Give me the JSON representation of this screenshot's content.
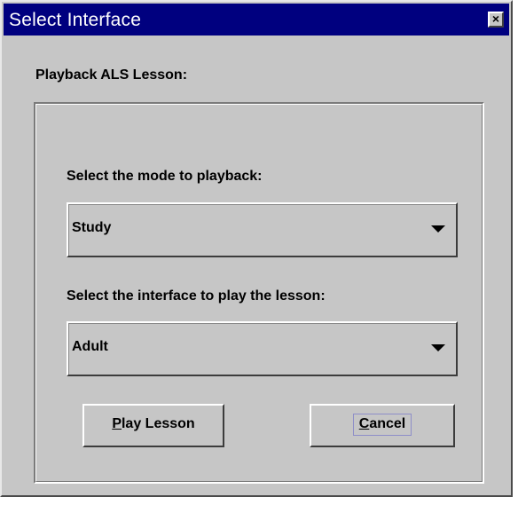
{
  "window": {
    "title": "Select Interface",
    "close_glyph": "×",
    "close_icon": "close-icon"
  },
  "group": {
    "label": "Playback ALS Lesson:"
  },
  "mode_field": {
    "label": "Select the mode to playback:",
    "selected": "Study",
    "dropdown_icon": "chevron-down-icon"
  },
  "interface_field": {
    "label": "Select the interface to play the lesson:",
    "selected": "Adult",
    "dropdown_icon": "chevron-down-icon"
  },
  "buttons": {
    "play": {
      "mnemonic": "P",
      "rest": "lay Lesson"
    },
    "cancel": {
      "mnemonic": "C",
      "rest": "ancel"
    }
  },
  "colors": {
    "title_bar": "#00007f",
    "dialog_bg": "#c6c6c6",
    "title_text": "#ffffff"
  }
}
